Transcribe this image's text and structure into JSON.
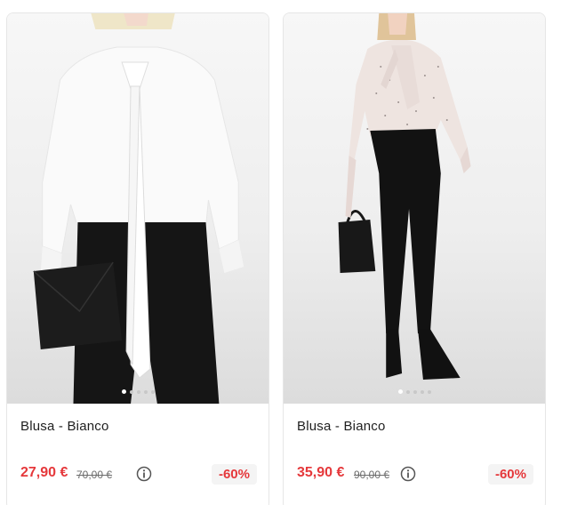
{
  "products": [
    {
      "title": "Blusa - Bianco",
      "price": "27,90 €",
      "old_price": "70,00 €",
      "discount": "-60%",
      "image_icon": "white-blouse-photo",
      "carousel": {
        "count": 5,
        "active": 1
      }
    },
    {
      "title": "Blusa - Bianco",
      "price": "35,90 €",
      "old_price": "90,00 €",
      "discount": "-60%",
      "image_icon": "printed-blouse-photo",
      "carousel": {
        "count": 5,
        "active": 1
      }
    }
  ],
  "colors": {
    "price_accent": "#e5383b",
    "border": "#e6e6e6"
  },
  "icons": {
    "info": "info-icon"
  }
}
